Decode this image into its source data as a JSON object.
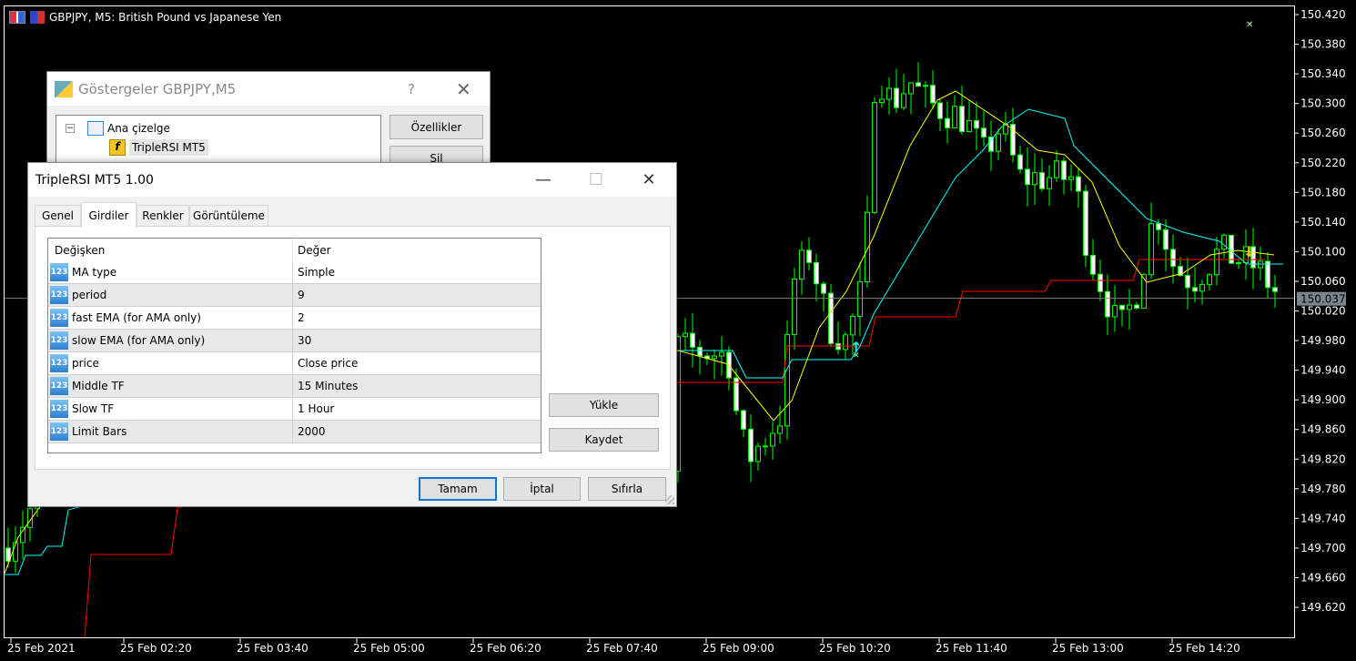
{
  "chart": {
    "title": "GBPJPY, M5:  British Pound vs Japanese Yen",
    "symbol": "GBPJPY",
    "timeframe": "M5",
    "price_labels": [
      "150.420",
      "150.380",
      "150.340",
      "150.300",
      "150.260",
      "150.220",
      "150.180",
      "150.140",
      "150.100",
      "150.060",
      "150.020",
      "149.980",
      "149.940",
      "149.900",
      "149.860",
      "149.820",
      "149.780",
      "149.740",
      "149.700",
      "149.660",
      "149.620"
    ],
    "current_price": "150.037",
    "time_labels": [
      "25 Feb 2021",
      "25 Feb 02:20",
      "25 Feb 03:40",
      "25 Feb 05:00",
      "25 Feb 06:20",
      "25 Feb 07:40",
      "25 Feb 09:00",
      "25 Feb 10:20",
      "25 Feb 11:40",
      "25 Feb 13:00",
      "25 Feb 14:20"
    ],
    "colors": {
      "background": "#000000",
      "candle": "#00ff00",
      "bear_body": "#ffffff",
      "line_fast": "#ffff00",
      "line_middle": "#00ffff",
      "line_slow": "#ff0000",
      "bid_line": "#808080"
    }
  },
  "indicators_dialog": {
    "title": "Göstergeler GBPJPY,M5",
    "help": "?",
    "tree_root": "Ana çizelge",
    "tree_child": "TripleRSI MT5",
    "properties_button": "Özellikler",
    "delete_button": "Sil"
  },
  "props_dialog": {
    "title": "TripleRSI MT5 1.00",
    "tabs": [
      {
        "label": "Genel"
      },
      {
        "label": "Girdiler",
        "active": true
      },
      {
        "label": "Renkler"
      },
      {
        "label": "Görüntüleme"
      }
    ],
    "columns": [
      "Değişken",
      "Değer"
    ],
    "rows": [
      {
        "name": "MA type",
        "value": "Simple"
      },
      {
        "name": "period",
        "value": "9"
      },
      {
        "name": "fast EMA (for AMA only)",
        "value": "2"
      },
      {
        "name": "slow EMA (for AMA only)",
        "value": "30"
      },
      {
        "name": "price",
        "value": "Close price"
      },
      {
        "name": "Middle TF",
        "value": "15 Minutes"
      },
      {
        "name": "Slow TF",
        "value": "1 Hour"
      },
      {
        "name": "Limit Bars",
        "value": "2000"
      }
    ],
    "row_icon": "123",
    "load_button": "Yükle",
    "save_button": "Kaydet",
    "ok_button": "Tamam",
    "cancel_button": "İptal",
    "reset_button": "Sıfırla"
  }
}
